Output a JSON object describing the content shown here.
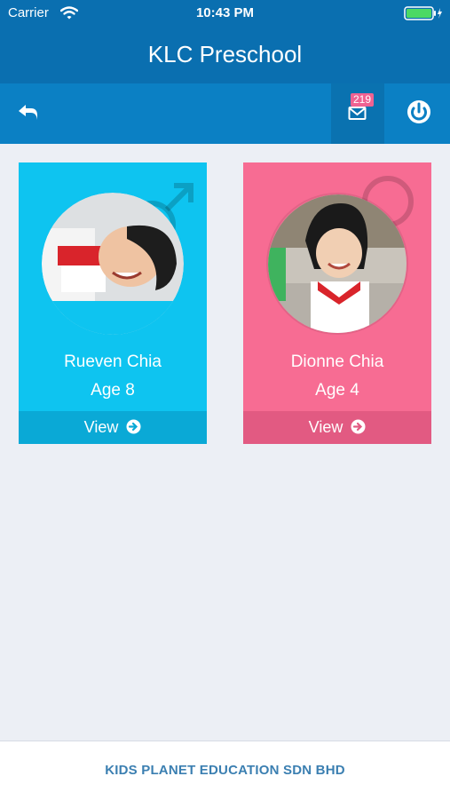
{
  "status_bar": {
    "carrier": "Carrier",
    "time": "10:43 PM"
  },
  "header": {
    "title": "KLC Preschool"
  },
  "toolbar": {
    "unread_count": "219"
  },
  "children": [
    {
      "name": "Rueven Chia",
      "age": "Age 8",
      "view_label": "View",
      "gender_icon": "male-symbol-icon",
      "card_color": "#0ec4f0"
    },
    {
      "name": "Dionne Chia",
      "age": "Age 4",
      "view_label": "View",
      "gender_icon": "female-symbol-icon",
      "card_color": "#f76c93"
    }
  ],
  "footer": {
    "text": "KIDS PLANET EDUCATION SDN BHD"
  },
  "colors": {
    "header": "#0a6fb0",
    "toolbar": "#0b80c4",
    "badge": "#f06292",
    "footer_text": "#3b7fb1"
  }
}
